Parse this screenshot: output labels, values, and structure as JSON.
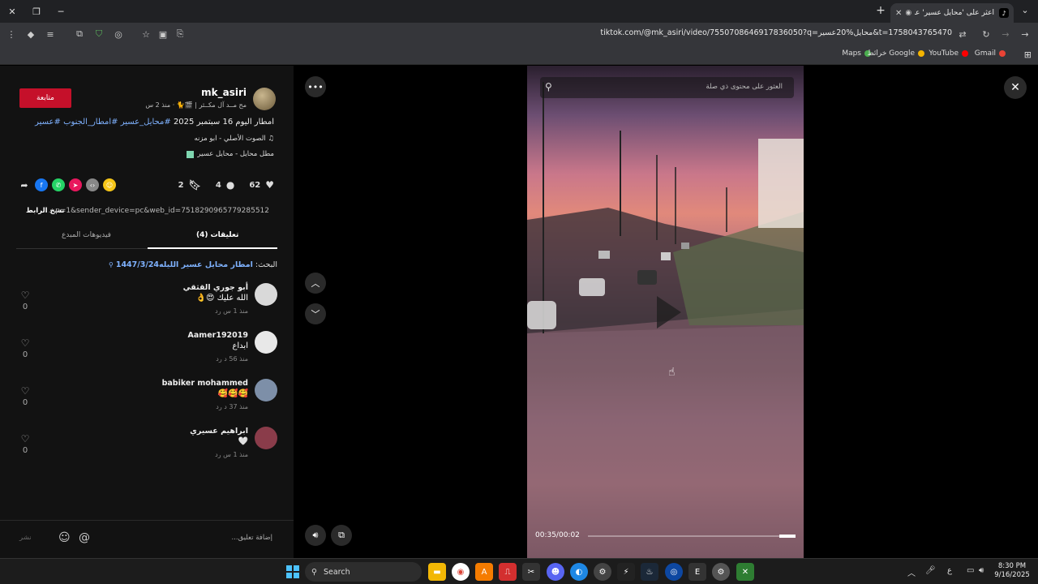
{
  "browser": {
    "tab_title": "اعثر على 'محايل عسير' على",
    "tab_favicon": "♪",
    "url": "tiktok.com/@mk_asiri/video/7550708646917836050?q=محايل%20عسير&t=1758043765470",
    "bookmarks": [
      {
        "label": "Maps",
        "color": "#4caf50"
      },
      {
        "label": "خرائط Google",
        "color": "#f4b400"
      },
      {
        "label": "YouTube",
        "color": "#ff0000"
      },
      {
        "label": "Gmail",
        "color": "#ea4335"
      }
    ]
  },
  "post": {
    "follow_label": "متابعة",
    "author_name": "mk_asiri",
    "author_sub": "مح مــد آل مكــثر | 🎬🐈 · منذ 2 س",
    "desc_text": "امطار اليوم 16 سبتمبر 2025 ",
    "desc_tags": "#محايل_عسير #امطار_الجنوب #عسير",
    "music": "♫ الصوت الأصلي - ابو مزنه",
    "effect": "مطل محايل - محايل عسير",
    "likes": "62",
    "comments": "4",
    "saves": "2",
    "copy_link_label": "نسخ الرابط",
    "link_text": "...p=1&sender_device=pc&web_id=7518290965779285512",
    "tab_comments": "تعليقات (4)",
    "tab_creator": "فيديوهات المبدع",
    "search_prefix": "البحث: ",
    "search_query": "امطار محايل عسير الليله1447/3/24"
  },
  "comments": [
    {
      "name": "أبو جوري القثقي",
      "text": "الله عليك 😍👌",
      "meta": "منذ 1 س   رد",
      "likes": "0",
      "avatar": "#d9d9d9"
    },
    {
      "name": "Aamer192019",
      "text": "ابداع",
      "meta": "منذ 56 د   رد",
      "likes": "0",
      "avatar": "#e8e8e8"
    },
    {
      "name": "babiker mohammed",
      "text": "🥰🥰🥰",
      "meta": "منذ 37 د   رد",
      "likes": "0",
      "avatar": "#7d8fa8"
    },
    {
      "name": "ابراهيم عسيري",
      "text": "🤍",
      "meta": "منذ 1 س   رد",
      "likes": "0",
      "avatar": "#8a3c4a"
    }
  ],
  "composer": {
    "placeholder": "إضافة تعليق...",
    "post_label": "نشر"
  },
  "video": {
    "search_placeholder": "العثور على محتوى ذي صلة",
    "time": "00:35/00:02",
    "progress": 0.08
  },
  "taskbar": {
    "search_label": "Search",
    "time": "8:30 PM",
    "date": "9/16/2025",
    "lang": "ع"
  }
}
